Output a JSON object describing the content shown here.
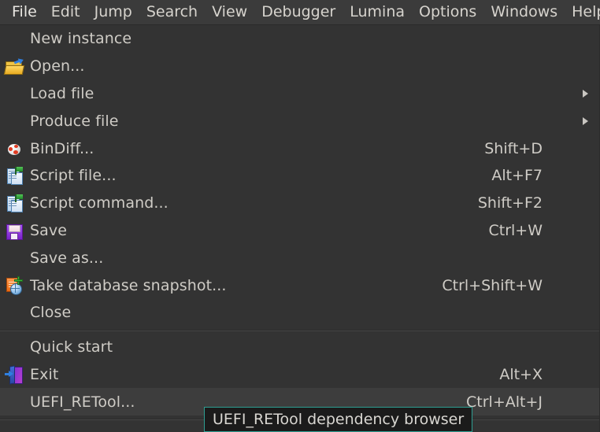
{
  "menubar": {
    "items": [
      {
        "label": "File",
        "active": true
      },
      {
        "label": "Edit",
        "active": false
      },
      {
        "label": "Jump",
        "active": false
      },
      {
        "label": "Search",
        "active": false
      },
      {
        "label": "View",
        "active": false
      },
      {
        "label": "Debugger",
        "active": false
      },
      {
        "label": "Lumina",
        "active": false
      },
      {
        "label": "Options",
        "active": false
      },
      {
        "label": "Windows",
        "active": false
      },
      {
        "label": "Help",
        "active": false
      }
    ]
  },
  "file_menu": {
    "items": [
      {
        "label": "New instance",
        "accel": "",
        "icon": "",
        "submenu": false,
        "highlighted": false
      },
      {
        "label": "Open...",
        "accel": "",
        "icon": "open-folder-icon",
        "submenu": false,
        "highlighted": false
      },
      {
        "label": "Load file",
        "accel": "",
        "icon": "",
        "submenu": true,
        "highlighted": false
      },
      {
        "label": "Produce file",
        "accel": "",
        "icon": "",
        "submenu": true,
        "highlighted": false
      },
      {
        "label": "BinDiff...",
        "accel": "Shift+D",
        "icon": "bindiff-icon",
        "submenu": false,
        "highlighted": false
      },
      {
        "label": "Script file...",
        "accel": "Alt+F7",
        "icon": "script-file-icon",
        "submenu": false,
        "highlighted": false
      },
      {
        "label": "Script command...",
        "accel": "Shift+F2",
        "icon": "script-command-icon",
        "submenu": false,
        "highlighted": false
      },
      {
        "label": "Save",
        "accel": "Ctrl+W",
        "icon": "save-disk-icon",
        "submenu": false,
        "highlighted": false
      },
      {
        "label": "Save as...",
        "accel": "",
        "icon": "",
        "submenu": false,
        "highlighted": false
      },
      {
        "label": "Take database snapshot...",
        "accel": "Ctrl+Shift+W",
        "icon": "snapshot-icon",
        "submenu": false,
        "highlighted": false
      },
      {
        "label": "Close",
        "accel": "",
        "icon": "",
        "submenu": false,
        "highlighted": false
      },
      {
        "label": "Quick start",
        "accel": "",
        "icon": "",
        "submenu": false,
        "highlighted": false
      },
      {
        "label": "Exit",
        "accel": "Alt+X",
        "icon": "exit-door-icon",
        "submenu": false,
        "highlighted": false
      },
      {
        "label": "UEFI_RETool...",
        "accel": "Ctrl+Alt+J",
        "icon": "",
        "submenu": false,
        "highlighted": true
      }
    ],
    "separator_after_indices": [
      10,
      13
    ]
  },
  "tooltip": {
    "text": "UEFI_RETool dependency browser"
  },
  "colors": {
    "menu_background": "#333333",
    "menubar_background": "#3b3b3b",
    "text": "#cfccc6",
    "highlight_row": "#3d3d3d",
    "tooltip_border": "#2e9e92",
    "tooltip_background": "#1b1b1b"
  }
}
